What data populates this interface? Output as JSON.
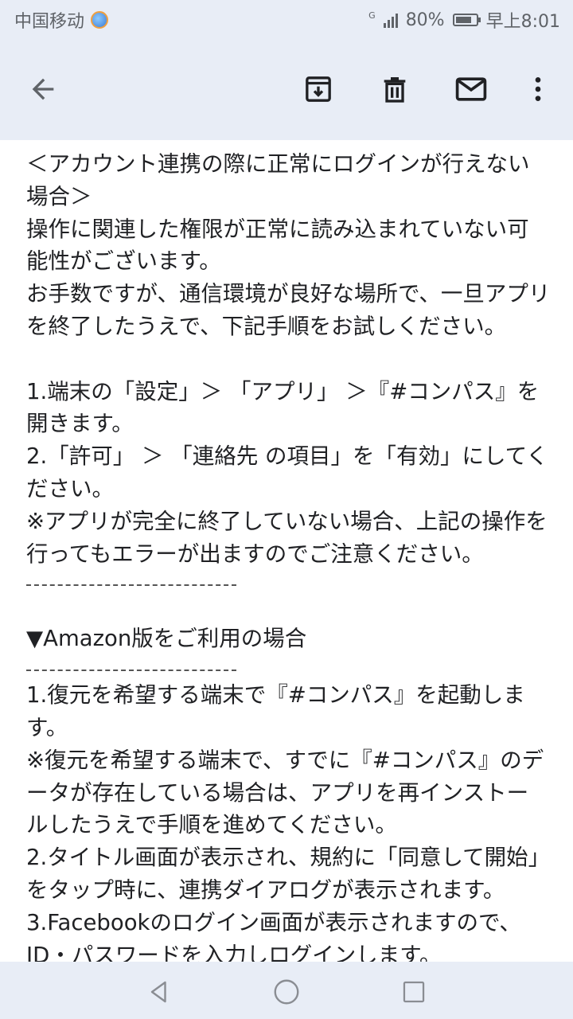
{
  "status_bar": {
    "carrier": "中国移动",
    "network": "G",
    "battery": "80%",
    "time": "早上8:01"
  },
  "toolbar": {
    "icons": [
      "back-arrow-icon",
      "archive-icon",
      "delete-icon",
      "mark-unread-icon",
      "more-vert-icon"
    ]
  },
  "email": {
    "lines": [
      "＜アカウント連携の際に正常にログインが行えない",
      "場合＞",
      "操作に関連した権限が正常に読み込まれていない可",
      "能性がございます。",
      "お手数ですが、通信環境が良好な場所で、一旦アプリ",
      "を終了したうえで、下記手順をお試しください。",
      "",
      "1.端末の「設定」＞ 「アプリ」 ＞『#コンパス』を",
      "開きます。",
      "2.「許可」 ＞ 「連絡先 の項目」を「有効」にしてく",
      "ださい。",
      "※アプリが完全に終了していない場合、上記の操作を",
      "行ってもエラーが出ますのでご注意ください。"
    ],
    "amazon_heading": "▼Amazon版をご利用の場合",
    "amazon_lines": [
      "1.復元を希望する端末で『#コンパス』を起動しま",
      "す。",
      "※復元を希望する端末で、すでに『#コンパス』のデ",
      "ータが存在している場合は、アプリを再インストー",
      "ルしたうえで手順を進めてください。",
      "2.タイトル画面が表示され、規約に「同意して開始」",
      "をタップ時に、連携ダイアログが表示されます。",
      "3.Facebookのログイン画面が表示されますので、",
      "ID・パスワードを入力しログインします。"
    ]
  },
  "nav_bar": {
    "icons": [
      "nav-back-icon",
      "nav-home-icon",
      "nav-recents-icon"
    ]
  }
}
